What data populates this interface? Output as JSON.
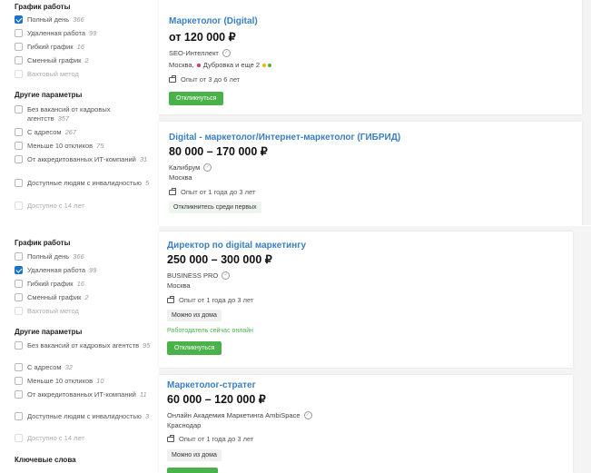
{
  "top": {
    "sidebar": {
      "schedule_title": "График работы",
      "schedule": [
        {
          "label": "Полный день",
          "count": "366",
          "checked": true
        },
        {
          "label": "Удаленная работа",
          "count": "99"
        },
        {
          "label": "Гибкий график",
          "count": "16"
        },
        {
          "label": "Сменный график",
          "count": "2"
        },
        {
          "label": "Вахтовый метод",
          "count": "",
          "disabled": true
        }
      ],
      "other_title": "Другие параметры",
      "other": [
        {
          "label": "Без вакансий от кадровых агентств",
          "count": "357"
        },
        {
          "label": "С адресом",
          "count": "267"
        },
        {
          "label": "Меньше 10 откликов",
          "count": "75"
        },
        {
          "label": "От аккредитованных ИТ-компаний",
          "count": "31"
        },
        {
          "label": "Доступные людям с инвалидностью",
          "count": "5"
        },
        {
          "label": "Доступно с 14 лет",
          "count": "",
          "disabled": true
        }
      ]
    },
    "cards": [
      {
        "title": "Маркетолог (Digital)",
        "salary": "от 120 000 ₽",
        "company": "SEO-Интеллект",
        "city_prefix": "Москва,",
        "metro": "Дубровка и еще 2",
        "experience": "Опыт от 3 до 6 лет",
        "button": "Откликнуться"
      },
      {
        "title": "Digital - маркетолог/Интернет-маркетолог (ГИБРИД)",
        "salary": "80 000 – 170 000 ₽",
        "company": "Калибрум",
        "city": "Москва",
        "experience": "Опыт от 1 года до 3 лет",
        "tag": "Откликнитесь среди первых"
      }
    ]
  },
  "bottom": {
    "sidebar": {
      "schedule_title": "График работы",
      "schedule": [
        {
          "label": "Полный день",
          "count": "366"
        },
        {
          "label": "Удаленная работа",
          "count": "99",
          "checked": true
        },
        {
          "label": "Гибкий график",
          "count": "16"
        },
        {
          "label": "Сменный график",
          "count": "2"
        },
        {
          "label": "Вахтовый метод",
          "count": "",
          "disabled": true
        }
      ],
      "other_title": "Другие параметры",
      "other": [
        {
          "label": "Без вакансий от кадровых агентств",
          "count": "95"
        },
        {
          "label": "С адресом",
          "count": "32"
        },
        {
          "label": "Меньше 10 откликов",
          "count": "10"
        },
        {
          "label": "От аккредитованных ИТ-компаний",
          "count": "11"
        },
        {
          "label": "Доступные людям с инвалидностью",
          "count": "3"
        },
        {
          "label": "Доступно с 14 лет",
          "count": "",
          "disabled": true
        }
      ],
      "keywords_title": "Ключевые слова"
    },
    "cards": [
      {
        "title": "Директор по digital маркетингу",
        "salary": "250 000 – 300 000 ₽",
        "company": "BUSINESS PRO",
        "city": "Москва",
        "experience": "Опыт от 1 года до 3 лет",
        "tag": "Можно из дома",
        "online": "Работодатель сейчас онлайн",
        "button": "Откликнуться"
      },
      {
        "title": "Маркетолог-стратег",
        "salary": "60 000 – 120 000 ₽",
        "company": "Онлайн Академия Маркетинга AmbiSpace",
        "city": "Краснодар",
        "experience": "Опыт от 1 года до 3 лет",
        "tag": "Можно из дома"
      }
    ]
  },
  "colors": {
    "accent": "#1a73c8",
    "title": "#3a7fc0",
    "button": "#4bb24b",
    "metro_red": "#d6336c",
    "metro_yellow": "#e6b800",
    "metro_green": "#4bb24b"
  }
}
